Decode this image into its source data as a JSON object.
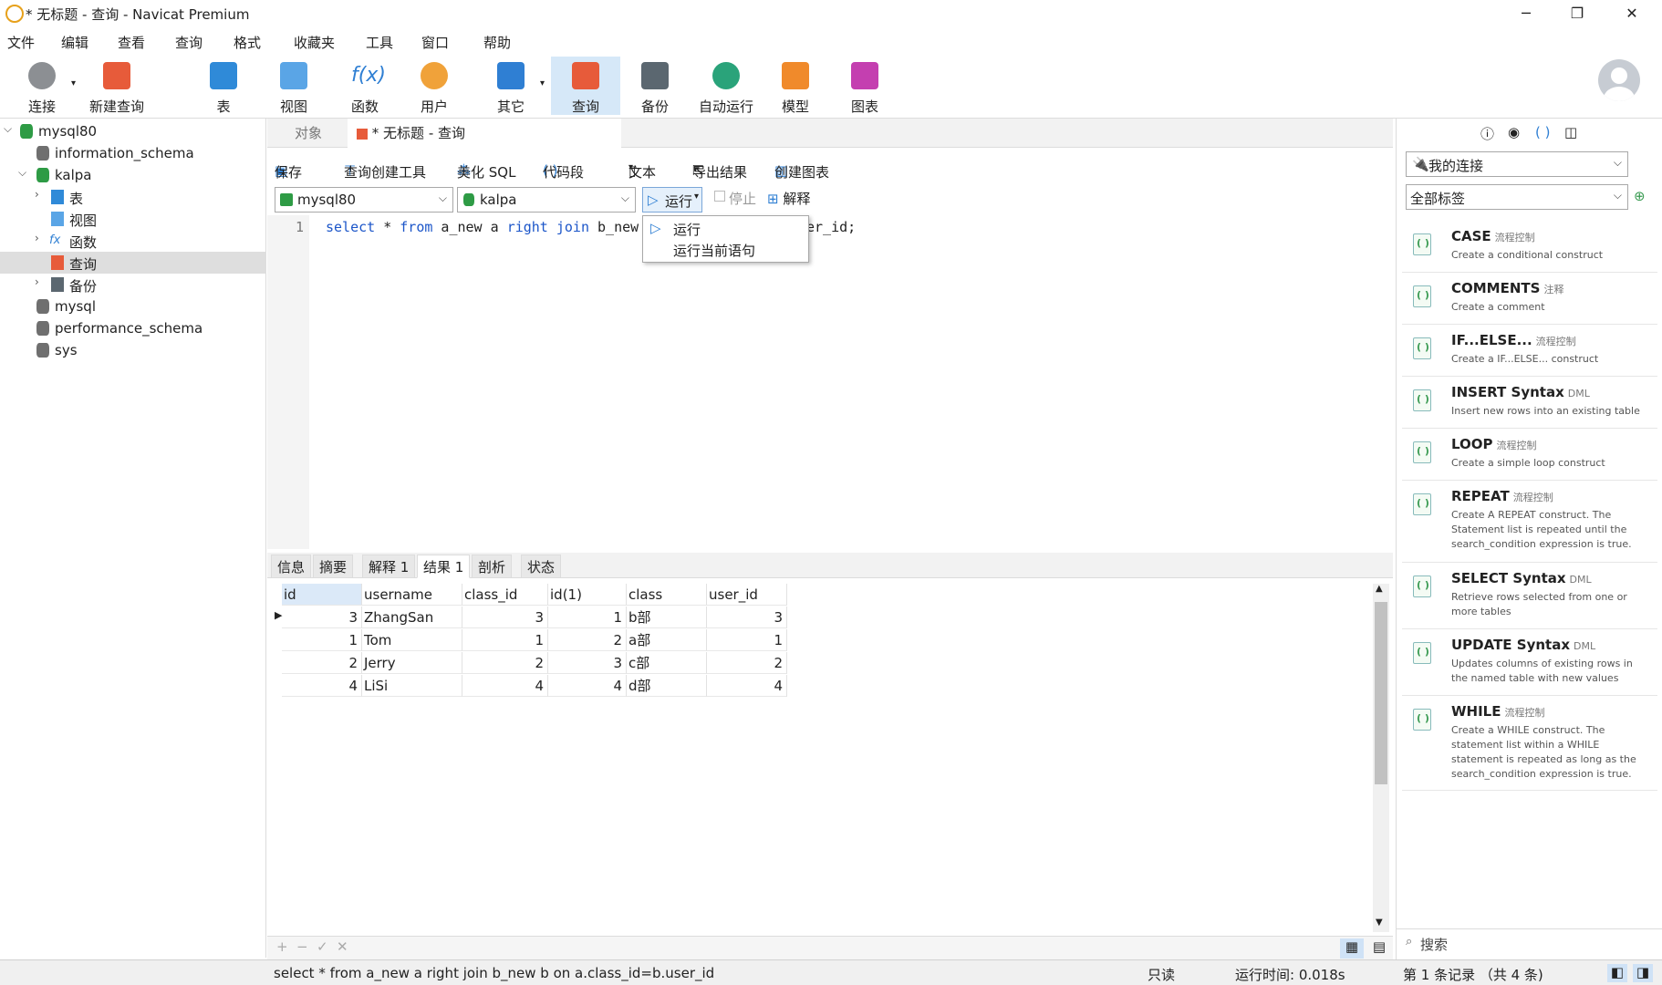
{
  "window": {
    "title": "* 无标题 - 查询 - Navicat Premium"
  },
  "menu": [
    "文件",
    "编辑",
    "查看",
    "查询",
    "格式",
    "收藏夹",
    "工具",
    "窗口",
    "帮助"
  ],
  "toolbar": {
    "connect": "连接",
    "new_query": "新建查询",
    "table": "表",
    "view": "视图",
    "function": "函数",
    "user": "用户",
    "other": "其它",
    "query": "查询",
    "backup": "备份",
    "automation": "自动运行",
    "model": "模型",
    "chart": "图表"
  },
  "sidebar": {
    "root": "mysql80",
    "items": [
      "information_schema",
      "kalpa",
      "表",
      "视图",
      "函数",
      "查询",
      "备份",
      "mysql",
      "performance_schema",
      "sys"
    ]
  },
  "tabs": {
    "objects": "对象",
    "query_tab": "* 无标题 - 查询"
  },
  "query_toolbar": {
    "save": "保存",
    "builder": "查询创建工具",
    "beautify": "美化 SQL",
    "snippet": "代码段",
    "text": "文本",
    "export": "导出结果",
    "create_chart": "创建图表"
  },
  "selectors": {
    "connection": "mysql80",
    "database": "kalpa",
    "run": "运行",
    "stop": "停止",
    "explain": "解释"
  },
  "editor": {
    "line_number": "1",
    "code_kw1": "select",
    "code_star": " * ",
    "code_kw2": "from",
    "code_mid": " a_new a ",
    "code_kw3": "right join",
    "code_tail_before": " b_new",
    "code_tail_after": "er_id;"
  },
  "run_menu": {
    "run": "运行",
    "run_current": "运行当前语句"
  },
  "result_tabs": [
    "信息",
    "摘要",
    "解释 1",
    "结果 1",
    "剖析",
    "状态"
  ],
  "result": {
    "columns": [
      "id",
      "username",
      "class_id",
      "id(1)",
      "class",
      "user_id"
    ],
    "rows": [
      [
        "3",
        "ZhangSan",
        "3",
        "1",
        "b部",
        "3"
      ],
      [
        "1",
        "Tom",
        "1",
        "2",
        "a部",
        "1"
      ],
      [
        "2",
        "Jerry",
        "2",
        "3",
        "c部",
        "2"
      ],
      [
        "4",
        "LiSi",
        "4",
        "4",
        "d部",
        "4"
      ]
    ]
  },
  "footer_tools": {
    "add": "+",
    "remove": "−",
    "apply": "✓",
    "cancel": "✕"
  },
  "status": {
    "sql": "select * from a_new a right join b_new b on a.class_id=b.user_id",
    "readonly": "只读",
    "time": "运行时间: 0.018s",
    "records": "第 1 条记录 （共 4 条)"
  },
  "right_panel": {
    "connection_select": "我的连接",
    "tag_select": "全部标签",
    "search_placeholder": "搜索",
    "snippets": [
      {
        "name": "CASE",
        "tag": "流程控制",
        "desc": "Create a conditional construct"
      },
      {
        "name": "COMMENTS",
        "tag": "注释",
        "desc": "Create a comment"
      },
      {
        "name": "IF...ELSE...",
        "tag": "流程控制",
        "desc": "Create a IF...ELSE... construct"
      },
      {
        "name": "INSERT Syntax",
        "tag": "DML",
        "desc": "Insert new rows into an existing table"
      },
      {
        "name": "LOOP",
        "tag": "流程控制",
        "desc": "Create a simple loop construct"
      },
      {
        "name": "REPEAT",
        "tag": "流程控制",
        "desc": "Create A REPEAT construct. The Statement list is repeated until the search_condition expression is true."
      },
      {
        "name": "SELECT Syntax",
        "tag": "DML",
        "desc": "Retrieve rows selected from one or more tables"
      },
      {
        "name": "UPDATE Syntax",
        "tag": "DML",
        "desc": "Updates columns of existing rows in the named table with new values"
      },
      {
        "name": "WHILE",
        "tag": "流程控制",
        "desc": "Create a WHILE construct. The statement list within a WHILE statement is repeated as long as the search_condition expression is true."
      }
    ]
  },
  "colors": {
    "accent": "#1c56c9",
    "active_tool": "#d6e8f8",
    "selected_row": "#dedede"
  }
}
